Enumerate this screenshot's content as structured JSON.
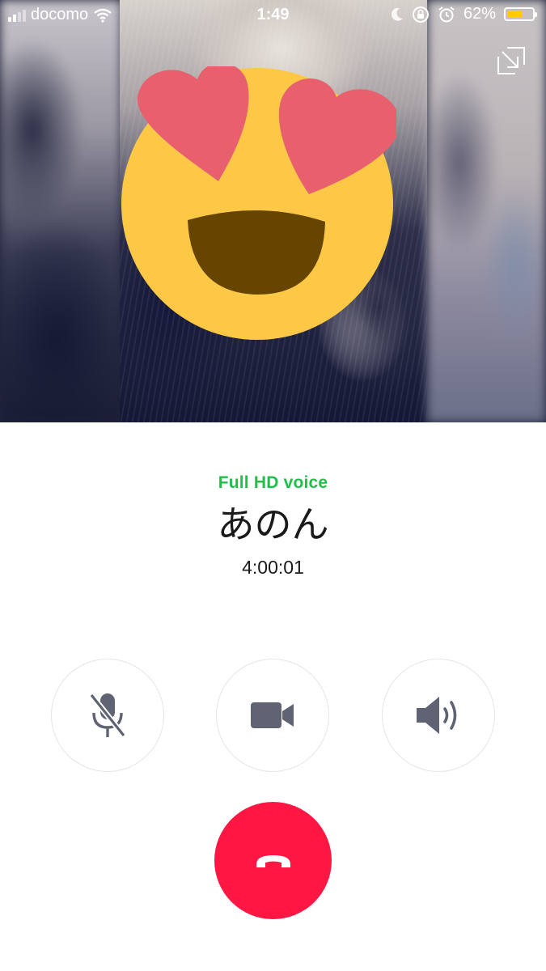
{
  "status_bar": {
    "carrier": "docomo",
    "time": "1:49",
    "battery_percent": "62%",
    "battery_level": 0.62,
    "battery_color": "#ffcc00",
    "signal_bars_filled": 2,
    "icons": [
      "signal-icon",
      "wifi-icon",
      "moon-icon",
      "orientation-lock-icon",
      "alarm-icon",
      "battery-icon"
    ]
  },
  "video_area": {
    "overlay_emoji": "heart-eyes-emoji",
    "minimize_icon": "minimize-arrow-icon"
  },
  "call": {
    "quality_label": "Full HD voice",
    "caller_name": "あのん",
    "duration": "4:00:01"
  },
  "controls": {
    "mute": {
      "icon": "microphone-muted-icon",
      "active": true
    },
    "video": {
      "icon": "video-camera-icon"
    },
    "speaker": {
      "icon": "speaker-icon"
    },
    "end_call": {
      "icon": "phone-hangup-icon",
      "color": "#ff1744"
    }
  },
  "colors": {
    "accent_green": "#1fbf4a",
    "icon_gray": "#5f6373",
    "end_call_red": "#ff1744"
  }
}
